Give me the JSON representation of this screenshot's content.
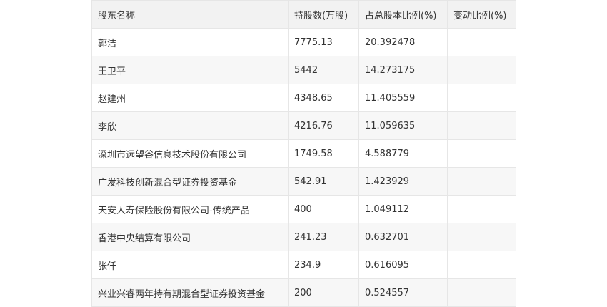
{
  "table": {
    "headers": [
      "股东名称",
      "持股数(万股)",
      "占总股本比例(%)",
      "变动比例(%)"
    ],
    "rows": [
      [
        "郭洁",
        "7775.13",
        "20.392478",
        ""
      ],
      [
        "王卫平",
        "5442",
        "14.273175",
        ""
      ],
      [
        "赵建州",
        "4348.65",
        "11.405559",
        ""
      ],
      [
        "李欣",
        "4216.76",
        "11.059635",
        ""
      ],
      [
        "深圳市远望谷信息技术股份有限公司",
        "1749.58",
        "4.588779",
        ""
      ],
      [
        "广发科技创新混合型证券投资基金",
        "542.91",
        "1.423929",
        ""
      ],
      [
        "天安人寿保险股份有限公司-传统产品",
        "400",
        "1.049112",
        ""
      ],
      [
        "香港中央结算有限公司",
        "241.23",
        "0.632701",
        ""
      ],
      [
        "张仟",
        "234.9",
        "0.616095",
        ""
      ],
      [
        "兴业兴睿两年持有期混合型证券投资基金",
        "200",
        "0.524557",
        ""
      ]
    ]
  }
}
